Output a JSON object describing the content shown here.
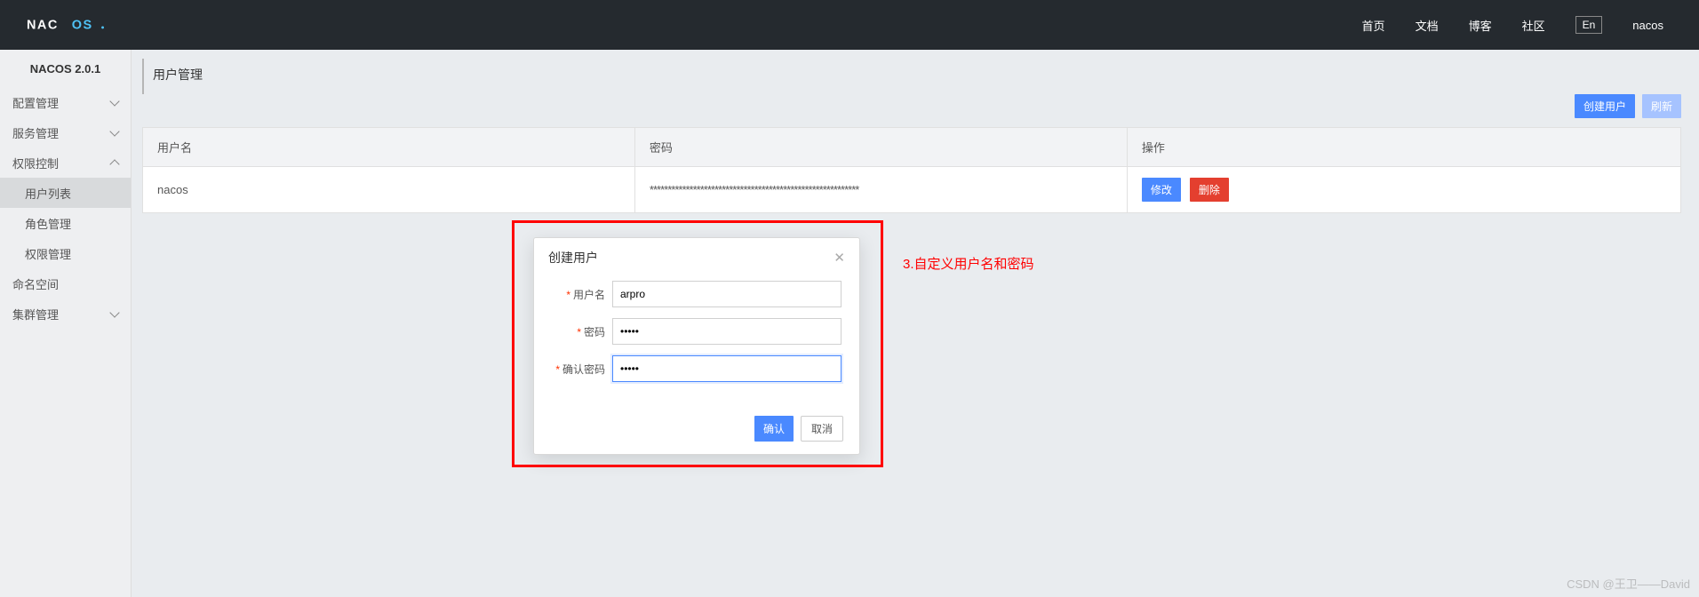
{
  "top": {
    "links": [
      "首页",
      "文档",
      "博客",
      "社区"
    ],
    "lang": "En",
    "user": "nacos"
  },
  "sidebar": {
    "version": "NACOS 2.0.1",
    "items": [
      {
        "label": "配置管理",
        "hasArrow": true,
        "expanded": false
      },
      {
        "label": "服务管理",
        "hasArrow": true,
        "expanded": false
      },
      {
        "label": "权限控制",
        "hasArrow": true,
        "expanded": true,
        "children": [
          {
            "label": "用户列表",
            "active": true
          },
          {
            "label": "角色管理",
            "active": false
          },
          {
            "label": "权限管理",
            "active": false
          }
        ]
      },
      {
        "label": "命名空间",
        "hasArrow": false
      },
      {
        "label": "集群管理",
        "hasArrow": true,
        "expanded": false
      }
    ]
  },
  "page": {
    "title": "用户管理",
    "toolbar": {
      "create": "创建用户",
      "refresh": "刷新"
    },
    "table": {
      "headers": {
        "user": "用户名",
        "password": "密码",
        "op": "操作"
      },
      "rows": [
        {
          "user": "nacos",
          "password": "**********************************************************",
          "ops": {
            "edit": "修改",
            "delete": "删除"
          }
        }
      ]
    }
  },
  "modal": {
    "title": "创建用户",
    "fields": {
      "username": {
        "label": "用户名",
        "value": "arpro"
      },
      "password": {
        "label": "密码",
        "value": "•••••"
      },
      "confirm": {
        "label": "确认密码",
        "value": "•••••"
      }
    },
    "ok": "确认",
    "cancel": "取消"
  },
  "annotation": "3.自定义用户名和密码",
  "watermark": "CSDN @王卫——David"
}
